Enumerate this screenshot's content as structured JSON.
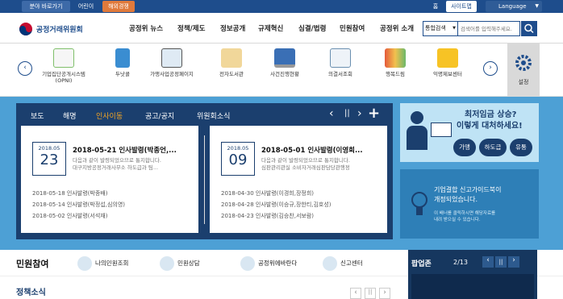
{
  "topbar": {
    "shortcuts_label": "분야 바로가기",
    "kids_label": "어린이",
    "english_label": "해외경쟁",
    "home_label": "홈",
    "sitemap_label": "사이트맵",
    "language_label": "Language"
  },
  "header": {
    "logo_text": "공정거래위원회",
    "nav": [
      "공정위 뉴스",
      "정책/제도",
      "정보공개",
      "규제혁신",
      "심결/법령",
      "민원참여",
      "공정위 소개"
    ],
    "search_select": "통합검색",
    "search_placeholder": "검색어를 입력해주세요."
  },
  "quick_menu": {
    "items": [
      {
        "label": "기업집단공개시스템 (OPNI)",
        "icon": "monitor-icon"
      },
      {
        "label": "두낫콜",
        "icon": "book-icon"
      },
      {
        "label": "가맹사업공정페이지",
        "icon": "display-icon"
      },
      {
        "label": "전자도서관",
        "icon": "open-book-icon"
      },
      {
        "label": "사건진행현황",
        "icon": "laptop-icon"
      },
      {
        "label": "의결서조회",
        "icon": "document-icon"
      },
      {
        "label": "행복드림",
        "icon": "person-icon"
      },
      {
        "label": "익명제보센터",
        "icon": "folder-icon"
      }
    ],
    "settings_label": "설정"
  },
  "news": {
    "tabs": [
      "보도",
      "해명",
      "인사이동",
      "공고/공지",
      "위원회소식"
    ],
    "active_tab": 2,
    "cards": [
      {
        "ym": "2018.05",
        "day": "23",
        "title": "2018-05-21 인사발령(박종언,...",
        "desc1": "다음과 같이 발령되었으므로 통지합니다.",
        "desc2": "대구지방공정거래사무소 하도급과 팀..."
      },
      {
        "ym": "2018.05",
        "day": "09",
        "title": "2018-05-01 인사발령(이영희...",
        "desc1": "다음과 같이 발령되었으므로 통지합니다.",
        "desc2": "심판관리관실 소비자거래심판담당관행정"
      }
    ],
    "list_left": [
      "2018-05-18 인사발령(박종배)",
      "2018-05-14 인사발령(박정섭,심의영)",
      "2018-05-02 인사발령(서석재)"
    ],
    "list_right": [
      "2018-04-30 인사발령(이경희,장정희)",
      "2018-04-28 인사발령(이승규,장한티,김호성)",
      "2018-04-23 인사발령(김승찬,서보람)"
    ]
  },
  "banner1": {
    "line1": "최저임금 상승?",
    "line2": "이렇게 대처하세요!",
    "buttons": [
      "가맹",
      "하도급",
      "유통"
    ]
  },
  "banner2": {
    "line1": "기업결합 신고가이드북이",
    "line2": "개정되었습니다.",
    "desc1": "이 배너를 클릭하시면 해당자료를",
    "desc2": "내려 받으실 수 있습니다."
  },
  "civil": {
    "title": "민원참여",
    "items": [
      "나의민원조회",
      "민원상담",
      "공정위에바란다",
      "신고센터"
    ]
  },
  "popup": {
    "title": "팝업존",
    "counter": "2/13"
  },
  "policy": {
    "title": "정책소식"
  },
  "colors": {
    "navy": "#1b3f6e",
    "sky": "#4da0d5",
    "accent": "#f5a623"
  }
}
